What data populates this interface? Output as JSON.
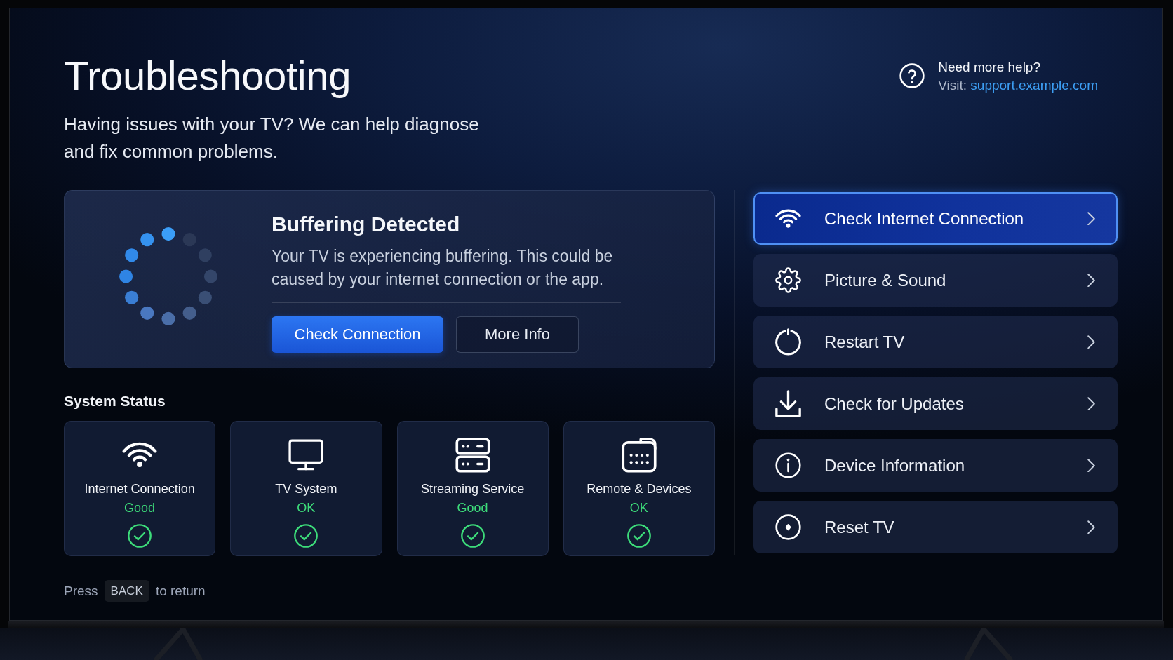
{
  "header": {
    "title": "Troubleshooting",
    "subtitle": "Having issues with your TV? We can help diagnose and fix common problems."
  },
  "help": {
    "title": "Need more help?",
    "visit_label": "Visit:",
    "link": "support.example.com"
  },
  "alert": {
    "title": "Buffering Detected",
    "message": "Your TV is experiencing buffering. This could be caused by your internet connection or the app.",
    "buttons": [
      {
        "label": "Check Connection",
        "kind": "primary"
      },
      {
        "label": "More Info",
        "kind": "secondary"
      }
    ]
  },
  "system_status": {
    "heading": "System Status",
    "items": [
      {
        "name": "Internet Connection",
        "status": "Good",
        "ok": true
      },
      {
        "name": "TV System",
        "status": "OK",
        "ok": true
      },
      {
        "name": "Streaming Service",
        "status": "Good",
        "ok": true
      },
      {
        "name": "Remote & Devices",
        "status": "OK",
        "ok": true
      }
    ]
  },
  "hint": {
    "before": "Press",
    "key": "BACK",
    "after": "to return"
  },
  "menu": {
    "items": [
      {
        "label": "Check Internet Connection",
        "selected": true
      },
      {
        "label": "Picture & Sound",
        "selected": false
      },
      {
        "label": "Restart TV",
        "selected": false
      },
      {
        "label": "Check for Updates",
        "selected": false
      },
      {
        "label": "Device Information",
        "selected": false
      },
      {
        "label": "Reset TV",
        "selected": false
      }
    ]
  }
}
